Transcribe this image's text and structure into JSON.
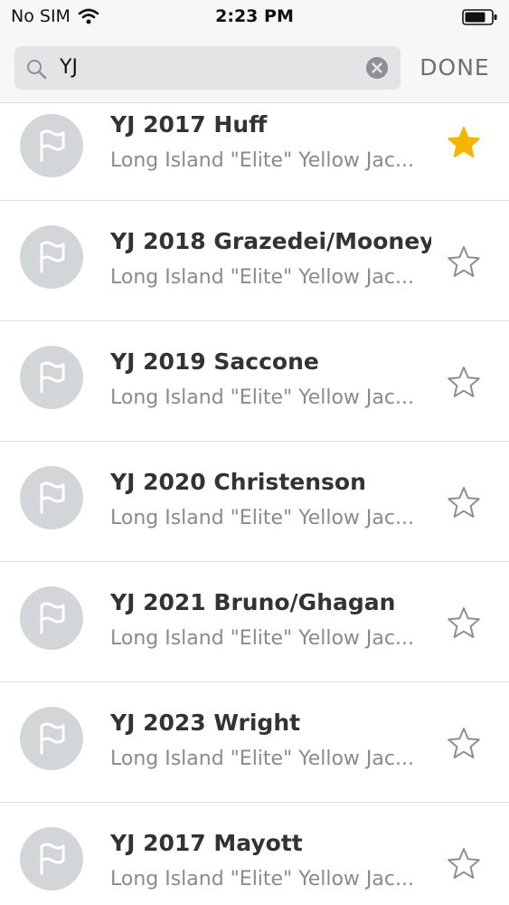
{
  "status_bar": {
    "carrier": "No SIM",
    "time": "2:23 PM"
  },
  "search": {
    "query": "YJ",
    "done_label": "DONE"
  },
  "colors": {
    "star_filled": "#f7b500",
    "star_outline": "#8e8e8e",
    "avatar_bg": "#d3d6d8"
  },
  "teams": [
    {
      "name": "YJ 2017 Huff",
      "org": "Long Island \"Elite\" Yellow Jac...",
      "favorite": true
    },
    {
      "name": "YJ 2018 Grazedei/Mooney",
      "org": "Long Island \"Elite\" Yellow Jac...",
      "favorite": false
    },
    {
      "name": "YJ 2019 Saccone",
      "org": "Long Island \"Elite\" Yellow Jac...",
      "favorite": false
    },
    {
      "name": "YJ 2020 Christenson",
      "org": "Long Island \"Elite\" Yellow Jac...",
      "favorite": false
    },
    {
      "name": "YJ 2021 Bruno/Ghagan",
      "org": "Long Island \"Elite\" Yellow Jac...",
      "favorite": false
    },
    {
      "name": "YJ 2023 Wright",
      "org": "Long Island \"Elite\" Yellow Jac...",
      "favorite": false
    },
    {
      "name": "YJ 2017 Mayott",
      "org": "Long Island \"Elite\" Yellow Jac...",
      "favorite": false
    }
  ]
}
